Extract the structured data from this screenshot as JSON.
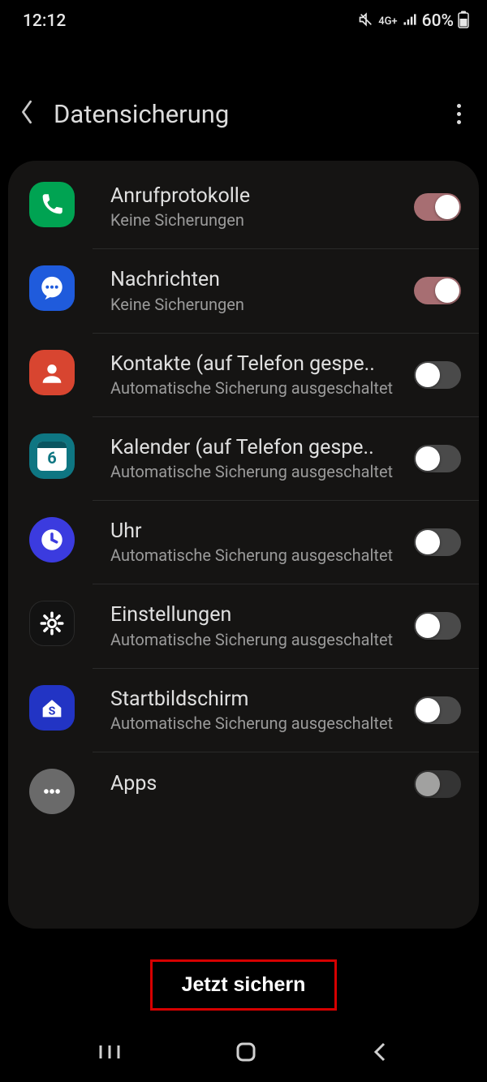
{
  "status": {
    "time": "12:12",
    "network_label": "4G+",
    "battery_pct": "60%"
  },
  "header": {
    "title": "Datensicherung"
  },
  "items": [
    {
      "title": "Anrufprotokolle",
      "sub": "Keine Sicherungen",
      "icon": "phone-icon",
      "toggle": true
    },
    {
      "title": "Nachrichten",
      "sub": "Keine Sicherungen",
      "icon": "messages-icon",
      "toggle": true
    },
    {
      "title": "Kontakte (auf Telefon gespe..",
      "sub": "Automatische Sicherung ausgeschaltet",
      "icon": "contacts-icon",
      "toggle": false
    },
    {
      "title": "Kalender (auf Telefon gespe..",
      "sub": "Automatische Sicherung ausgeschaltet",
      "icon": "calendar-icon",
      "toggle": false,
      "cal_day": "6"
    },
    {
      "title": "Uhr",
      "sub": "Automatische Sicherung ausgeschaltet",
      "icon": "clock-icon",
      "toggle": false
    },
    {
      "title": "Einstellungen",
      "sub": "Automatische Sicherung ausgeschaltet",
      "icon": "settings-icon",
      "toggle": false
    },
    {
      "title": "Startbildschirm",
      "sub": "Automatische Sicherung ausgeschaltet",
      "icon": "home-icon",
      "toggle": false
    },
    {
      "title": "Apps",
      "sub": "",
      "icon": "apps-icon",
      "toggle": false
    }
  ],
  "action": {
    "backup_now": "Jetzt sichern"
  }
}
